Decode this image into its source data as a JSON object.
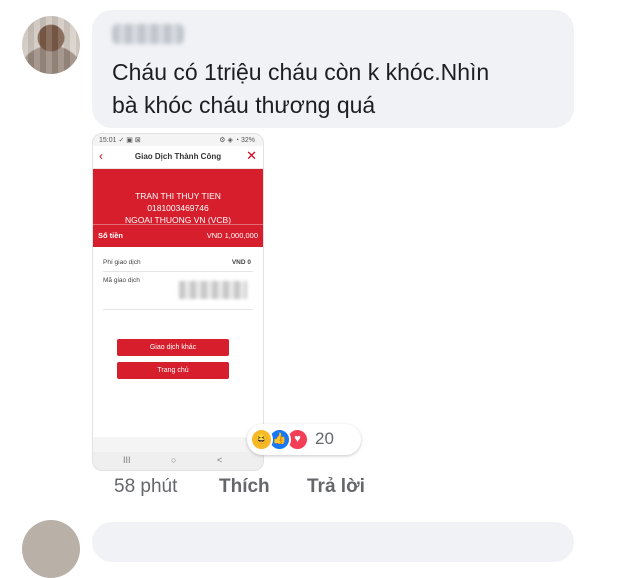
{
  "comment": {
    "text": "Cháu có 1triệu cháu còn k khóc.Nhìn\nbà khóc cháu thương quá"
  },
  "phone": {
    "status_left": "15:01 ✓ ▣ ⊠",
    "status_right": "⚙ ◈ ◔ 32%",
    "title": "Giao Dịch Thành Công",
    "recipient_name": "TRAN THI THUY TIEN",
    "account_number": "0181003469746",
    "bank": "NGOAI THUONG VN (VCB)",
    "amount_label": "Số tiền",
    "amount_value": "VND  1,000,000",
    "fee_label": "Phí giao dịch",
    "fee_value": "VND 0",
    "code_label": "Mã giao dịch",
    "btn_other": "Giao dịch khác",
    "btn_home": "Trang chủ",
    "nav_recent": "III",
    "nav_home": "○",
    "nav_back": "<"
  },
  "reactions": {
    "count": "20",
    "icons": [
      "haha-icon",
      "like-icon",
      "love-icon"
    ]
  },
  "actions": {
    "time": "58 phút",
    "like": "Thích",
    "reply": "Trả lời"
  },
  "colors": {
    "bubble": "#f0f2f5",
    "bank_red": "#d61e2c",
    "like_blue": "#1877f2",
    "love_red": "#f33e58",
    "haha_yellow": "#f7b928",
    "meta_gray": "#65676b"
  }
}
